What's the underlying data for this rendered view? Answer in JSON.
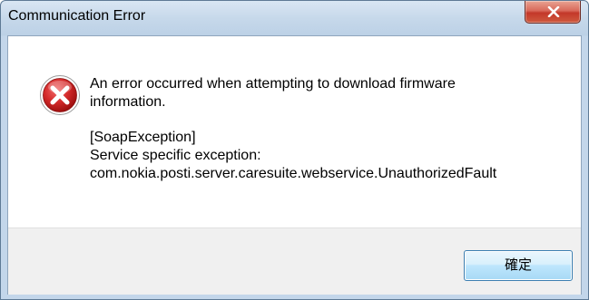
{
  "window": {
    "title": "Communication Error"
  },
  "message": {
    "line1": "An error occurred when attempting to download firmware",
    "line2": "information.",
    "line3": "[SoapException]",
    "line4": "Service specific exception:",
    "line5": "com.nokia.posti.server.caresuite.webservice.UnauthorizedFault"
  },
  "buttons": {
    "ok_label": "確定"
  },
  "icons": {
    "error": "error-icon",
    "close": "close-icon"
  },
  "colors": {
    "error_red": "#c8202a",
    "close_button_red": "#c3382a",
    "title_bar": "#c6d8ea"
  }
}
